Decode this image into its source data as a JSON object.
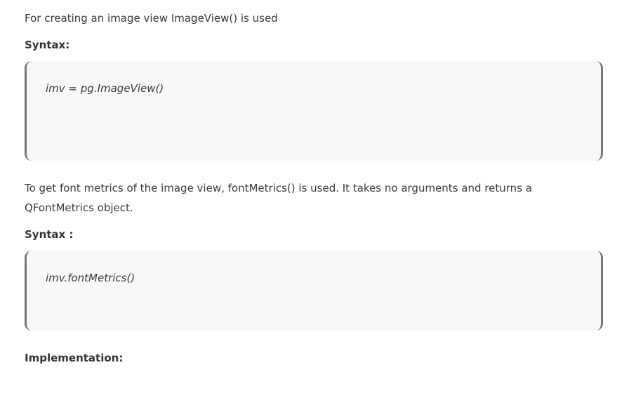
{
  "intro": {
    "text": "For creating an image view ImageView() is used"
  },
  "syntax_1": {
    "heading": "Syntax:",
    "code": "imv = pg.ImageView()"
  },
  "description": {
    "text": "To get font metrics of the image view, fontMetrics() is used. It takes no arguments and returns a QFontMetrics object."
  },
  "syntax_2": {
    "heading": "Syntax :",
    "code": "imv.fontMetrics()"
  },
  "implementation": {
    "heading": "Implementation:"
  }
}
